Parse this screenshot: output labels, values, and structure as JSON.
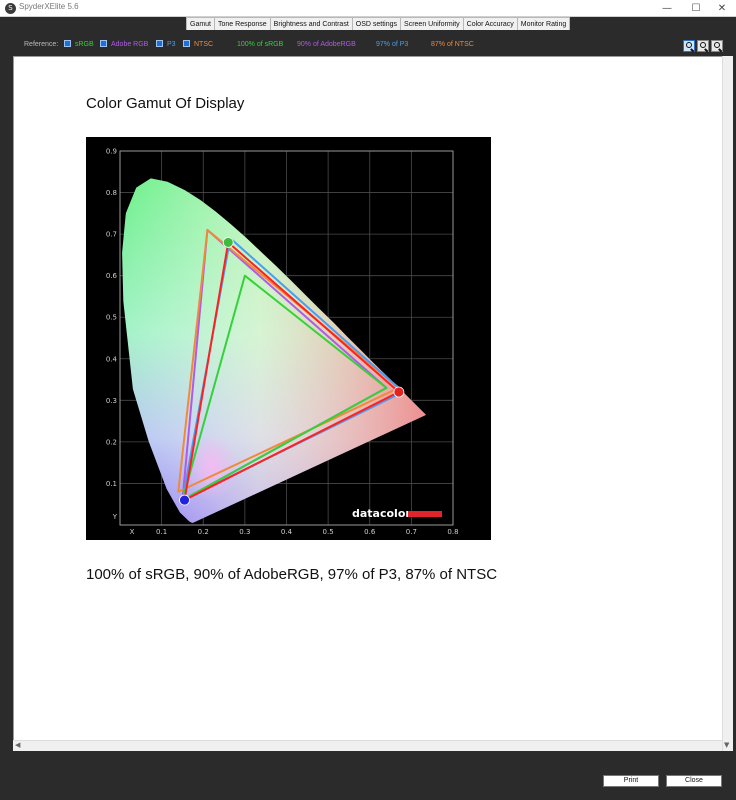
{
  "window": {
    "title": "SpyderXElite 5.6",
    "icon_glyph": "S",
    "controls": {
      "minimize": "—",
      "maximize": "☐",
      "close": "✕"
    }
  },
  "tabs": [
    {
      "label": "Gamut",
      "active": true
    },
    {
      "label": "Tone Response",
      "active": false
    },
    {
      "label": "Brightness and Contrast",
      "active": false
    },
    {
      "label": "OSD settings",
      "active": false
    },
    {
      "label": "Screen Uniformity",
      "active": false
    },
    {
      "label": "Color Accuracy",
      "active": false
    },
    {
      "label": "Monitor Rating",
      "active": false
    }
  ],
  "reference": {
    "label": "Reference:",
    "items": [
      {
        "label": "sRGB",
        "checked": true,
        "color": "#35d13a"
      },
      {
        "label": "Adobe RGB",
        "checked": true,
        "color": "#b05ae8"
      },
      {
        "label": "P3",
        "checked": true,
        "color": "#4a9df0"
      },
      {
        "label": "NTSC",
        "checked": true,
        "color": "#f08a3a"
      }
    ],
    "results": [
      {
        "text": "100% of sRGB",
        "color": "#35d13a"
      },
      {
        "text": "90% of AdobeRGB",
        "color": "#b05ae8"
      },
      {
        "text": "97% of P3",
        "color": "#4a9df0"
      },
      {
        "text": "87% of NTSC",
        "color": "#f08a3a"
      }
    ]
  },
  "zoom_buttons": [
    "zoom-in-icon",
    "zoom-out-icon",
    "zoom-fit-icon"
  ],
  "content": {
    "heading": "Color Gamut Of Display",
    "summary": "100% of sRGB, 90% of AdobeRGB, 97% of P3, 87% of NTSC"
  },
  "buttons": {
    "print": "Print",
    "close": "Close"
  },
  "chart_data": {
    "type": "scatter",
    "xlabel": "X",
    "ylabel": "Y",
    "xlim": [
      0,
      0.8
    ],
    "ylim": [
      0,
      0.9
    ],
    "x_ticks": [
      "0.1",
      "0.2",
      "0.3",
      "0.4",
      "0.5",
      "0.6",
      "0.7",
      "0.8"
    ],
    "y_ticks": [
      "0.1",
      "0.2",
      "0.3",
      "0.4",
      "0.5",
      "0.6",
      "0.7",
      "0.8",
      "0.9"
    ],
    "grid": true,
    "logo": "datacolor",
    "series": [
      {
        "name": "Adobe RGB",
        "color": "#b05ae8",
        "x": [
          0.64,
          0.21,
          0.15
        ],
        "y": [
          0.33,
          0.71,
          0.06
        ]
      },
      {
        "name": "NTSC",
        "color": "#f08a3a",
        "x": [
          0.67,
          0.21,
          0.14
        ],
        "y": [
          0.33,
          0.71,
          0.08
        ]
      },
      {
        "name": "P3",
        "color": "#4a9df0",
        "x": [
          0.68,
          0.265,
          0.15
        ],
        "y": [
          0.32,
          0.69,
          0.06
        ]
      },
      {
        "name": "sRGB",
        "color": "#35d13a",
        "x": [
          0.64,
          0.3,
          0.15
        ],
        "y": [
          0.33,
          0.6,
          0.06
        ]
      },
      {
        "name": "Display",
        "color": "#ff2020",
        "x": [
          0.67,
          0.26,
          0.155
        ],
        "y": [
          0.32,
          0.68,
          0.06
        ]
      }
    ],
    "primaries": [
      {
        "x": 0.67,
        "y": 0.32,
        "color": "#e32222"
      },
      {
        "x": 0.26,
        "y": 0.68,
        "color": "#3dbb3d"
      },
      {
        "x": 0.155,
        "y": 0.06,
        "color": "#2222dd"
      }
    ],
    "spectral_locus": {
      "x": [
        0.175,
        0.174,
        0.171,
        0.166,
        0.144,
        0.112,
        0.069,
        0.031,
        0.008,
        0.005,
        0.014,
        0.039,
        0.074,
        0.114,
        0.155,
        0.193,
        0.23,
        0.266,
        0.302,
        0.337,
        0.373,
        0.408,
        0.444,
        0.479,
        0.513,
        0.545,
        0.575,
        0.603,
        0.627,
        0.648,
        0.666,
        0.68,
        0.691,
        0.719,
        0.735
      ],
      "y": [
        0.005,
        0.005,
        0.006,
        0.009,
        0.03,
        0.087,
        0.201,
        0.327,
        0.538,
        0.655,
        0.75,
        0.812,
        0.834,
        0.826,
        0.806,
        0.782,
        0.754,
        0.724,
        0.692,
        0.659,
        0.625,
        0.591,
        0.555,
        0.52,
        0.487,
        0.454,
        0.424,
        0.396,
        0.372,
        0.352,
        0.333,
        0.32,
        0.309,
        0.281,
        0.265
      ]
    }
  }
}
